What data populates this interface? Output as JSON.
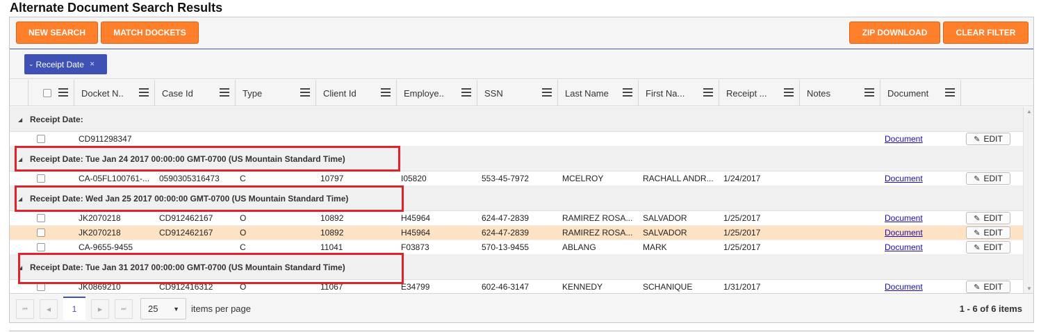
{
  "page_title": "Alternate Document Search Results",
  "toolbar": {
    "new_search": "NEW SEARCH",
    "match_dockets": "MATCH DOCKETS",
    "zip_download": "ZIP DOWNLOAD",
    "clear_filter": "CLEAR FILTER"
  },
  "group_chip": {
    "label": "Receipt Date"
  },
  "columns": [
    "Docket N..",
    "Case Id",
    "Type",
    "Client Id",
    "Employe..",
    "SSN",
    "Last Name",
    "First Na...",
    "Receipt ...",
    "Notes",
    "Document"
  ],
  "groups": [
    {
      "label": "Receipt Date:"
    },
    {
      "label": "Receipt Date: Tue Jan 24 2017 00:00:00 GMT-0700 (US Mountain Standard Time)"
    },
    {
      "label": "Receipt Date: Wed Jan 25 2017 00:00:00 GMT-0700 (US Mountain Standard Time)"
    },
    {
      "label": "Receipt Date: Tue Jan 31 2017 00:00:00 GMT-0700 (US Mountain Standard Time)"
    }
  ],
  "rows": [
    {
      "docket": "CD911298347",
      "case": "",
      "type": "",
      "client": "",
      "employee": "",
      "ssn": "",
      "last": "",
      "first": "",
      "receipt": "",
      "notes": "",
      "document": "Document",
      "edit": "EDIT"
    },
    {
      "docket": "CA-05FL100761-...",
      "case": "0590305316473",
      "type": "C",
      "client": "10797",
      "employee": "I05820",
      "ssn": "553-45-7972",
      "last": "MCELROY",
      "first": "RACHALL ANDR...",
      "receipt": "1/24/2017",
      "notes": "",
      "document": "Document",
      "edit": "EDIT"
    },
    {
      "docket": "JK2070218",
      "case": "CD912462167",
      "type": "O",
      "client": "10892",
      "employee": "H45964",
      "ssn": "624-47-2839",
      "last": "RAMIREZ ROSA...",
      "first": "SALVADOR",
      "receipt": "1/25/2017",
      "notes": "",
      "document": "Document",
      "edit": "EDIT"
    },
    {
      "docket": "JK2070218",
      "case": "CD912462167",
      "type": "O",
      "client": "10892",
      "employee": "H45964",
      "ssn": "624-47-2839",
      "last": "RAMIREZ ROSA...",
      "first": "SALVADOR",
      "receipt": "1/25/2017",
      "notes": "",
      "document": "Document",
      "edit": "EDIT"
    },
    {
      "docket": "CA-9655-9455",
      "case": "",
      "type": "C",
      "client": "11041",
      "employee": "F03873",
      "ssn": "570-13-9455",
      "last": "ABLANG",
      "first": "MARK",
      "receipt": "1/25/2017",
      "notes": "",
      "document": "Document",
      "edit": "EDIT"
    },
    {
      "docket": "JK0869210",
      "case": "CD912416312",
      "type": "O",
      "client": "11067",
      "employee": "E34799",
      "ssn": "602-46-3147",
      "last": "KENNEDY",
      "first": "SCHANIQUE",
      "receipt": "1/31/2017",
      "notes": "",
      "document": "Document",
      "edit": "EDIT"
    }
  ],
  "pager": {
    "current_page": "1",
    "page_size": "25",
    "items_per_page": "items per page",
    "info": "1 - 6 of 6 items"
  },
  "colors": {
    "accent_orange": "#ff7f2a",
    "primary_blue": "#3f51b5",
    "selected_row": "#fde3c3",
    "highlight_red": "#e0222a"
  }
}
